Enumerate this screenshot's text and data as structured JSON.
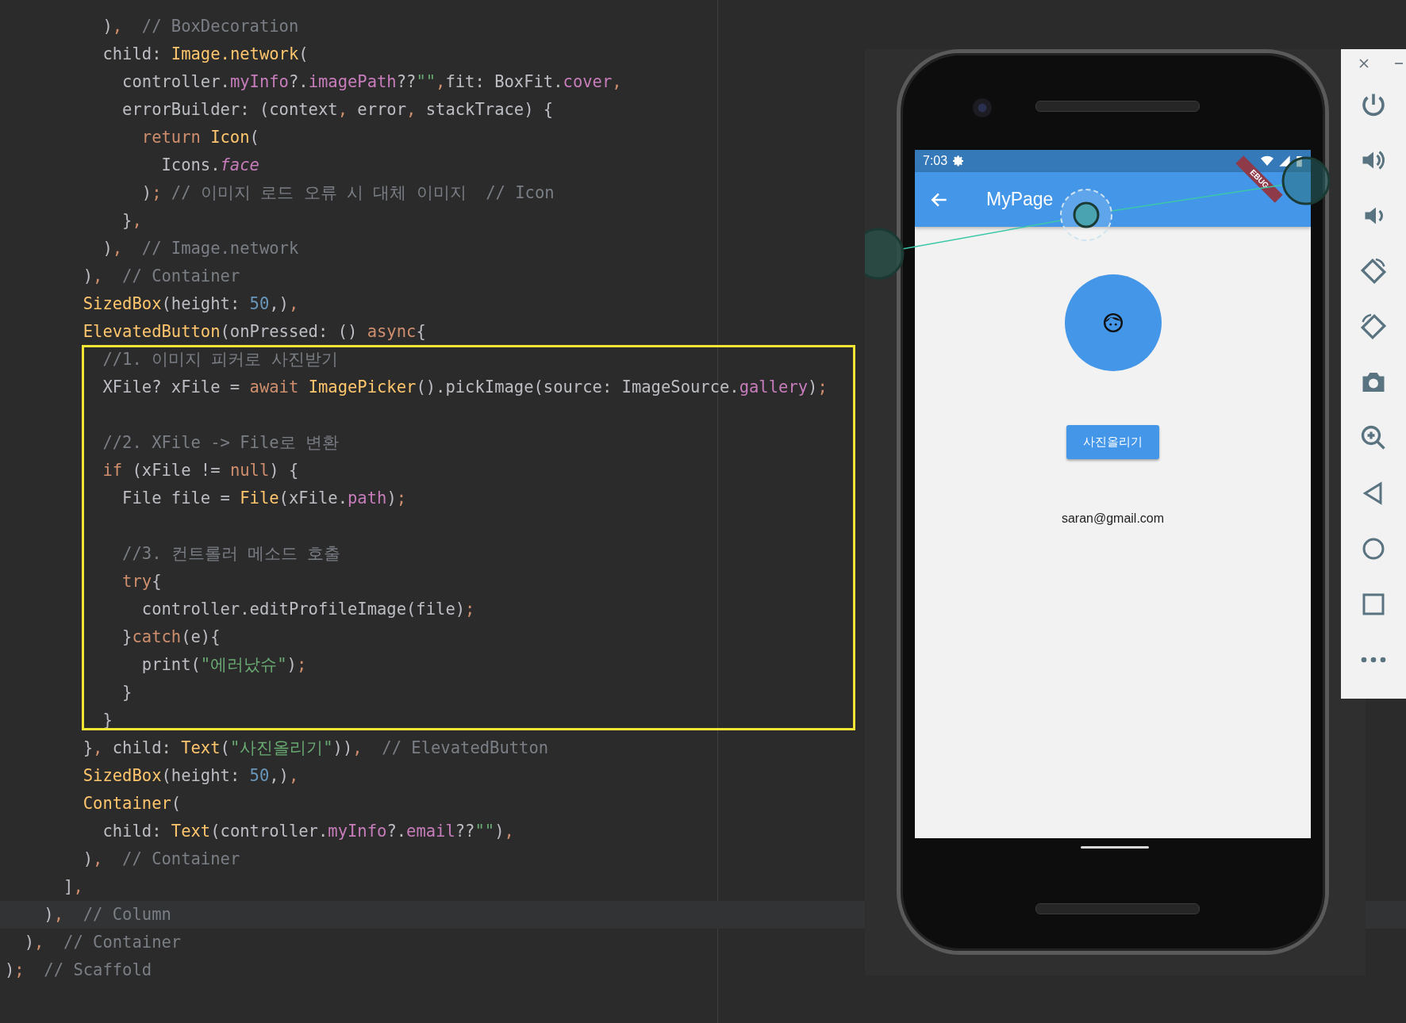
{
  "editor": {
    "lines": [
      {
        "current": false,
        "tokens": [
          {
            "kind": "plain",
            "text": "          )"
          },
          {
            "kind": "keyword",
            "text": ","
          },
          {
            "kind": "comment",
            "text": "  // BoxDecoration"
          }
        ]
      },
      {
        "current": false,
        "tokens": [
          {
            "kind": "plain",
            "text": "          child: "
          },
          {
            "kind": "class",
            "text": "Image.network"
          },
          {
            "kind": "plain",
            "text": "("
          }
        ]
      },
      {
        "current": false,
        "tokens": [
          {
            "kind": "plain",
            "text": "            controller."
          },
          {
            "kind": "field",
            "text": "myInfo"
          },
          {
            "kind": "plain",
            "text": "?."
          },
          {
            "kind": "field",
            "text": "imagePath"
          },
          {
            "kind": "plain",
            "text": "??"
          },
          {
            "kind": "string",
            "text": "\"\""
          },
          {
            "kind": "keyword",
            "text": ","
          },
          {
            "kind": "plain",
            "text": "fit: BoxFit."
          },
          {
            "kind": "field",
            "text": "cover"
          },
          {
            "kind": "keyword",
            "text": ","
          }
        ]
      },
      {
        "current": false,
        "tokens": [
          {
            "kind": "plain",
            "text": "            errorBuilder: (context"
          },
          {
            "kind": "keyword",
            "text": ","
          },
          {
            "kind": "plain",
            "text": " error"
          },
          {
            "kind": "keyword",
            "text": ","
          },
          {
            "kind": "plain",
            "text": " stackTrace) {"
          }
        ]
      },
      {
        "current": false,
        "tokens": [
          {
            "kind": "keyword",
            "text": "              return "
          },
          {
            "kind": "class",
            "text": "Icon"
          },
          {
            "kind": "plain",
            "text": "("
          }
        ]
      },
      {
        "current": false,
        "tokens": [
          {
            "kind": "plain",
            "text": "                Icons."
          },
          {
            "kind": "italic",
            "text": "face"
          }
        ]
      },
      {
        "current": false,
        "tokens": [
          {
            "kind": "plain",
            "text": "              )"
          },
          {
            "kind": "keyword",
            "text": ";"
          },
          {
            "kind": "comment",
            "text": " // 이미지 로드 오류 시 대체 이미지  // Icon"
          }
        ]
      },
      {
        "current": false,
        "tokens": [
          {
            "kind": "plain",
            "text": "            }"
          },
          {
            "kind": "keyword",
            "text": ","
          }
        ]
      },
      {
        "current": false,
        "tokens": [
          {
            "kind": "plain",
            "text": "          )"
          },
          {
            "kind": "keyword",
            "text": ","
          },
          {
            "kind": "comment",
            "text": "  // Image.network"
          }
        ]
      },
      {
        "current": false,
        "tokens": [
          {
            "kind": "plain",
            "text": "        )"
          },
          {
            "kind": "keyword",
            "text": ","
          },
          {
            "kind": "comment",
            "text": "  // Container"
          }
        ]
      },
      {
        "current": false,
        "tokens": [
          {
            "kind": "class",
            "text": "        SizedBox"
          },
          {
            "kind": "plain",
            "text": "(height: "
          },
          {
            "kind": "number",
            "text": "50"
          },
          {
            "kind": "plain",
            "text": ",)"
          },
          {
            "kind": "keyword",
            "text": ","
          }
        ]
      },
      {
        "current": false,
        "tokens": [
          {
            "kind": "class",
            "text": "        ElevatedButton"
          },
          {
            "kind": "plain",
            "text": "(onPressed: () "
          },
          {
            "kind": "keyword",
            "text": "async"
          },
          {
            "kind": "plain",
            "text": "{"
          }
        ]
      },
      {
        "current": false,
        "tokens": [
          {
            "kind": "comment",
            "text": "          //1. 이미지 피커로 사진받기"
          }
        ]
      },
      {
        "current": false,
        "tokens": [
          {
            "kind": "plain",
            "text": "          XFile? xFile = "
          },
          {
            "kind": "keyword",
            "text": "await "
          },
          {
            "kind": "class",
            "text": "ImagePicker"
          },
          {
            "kind": "plain",
            "text": "().pickImage(source: ImageSource."
          },
          {
            "kind": "field",
            "text": "gallery"
          },
          {
            "kind": "plain",
            "text": ")"
          },
          {
            "kind": "keyword",
            "text": ";"
          }
        ]
      },
      {
        "current": false
      },
      {
        "current": false,
        "tokens": [
          {
            "kind": "comment",
            "text": "          //2. XFile -> File로 변환"
          }
        ]
      },
      {
        "current": false,
        "tokens": [
          {
            "kind": "keyword",
            "text": "          if "
          },
          {
            "kind": "plain",
            "text": "(xFile != "
          },
          {
            "kind": "keyword",
            "text": "null"
          },
          {
            "kind": "plain",
            "text": ") {"
          }
        ]
      },
      {
        "current": false,
        "tokens": [
          {
            "kind": "plain",
            "text": "            File file = "
          },
          {
            "kind": "class",
            "text": "File"
          },
          {
            "kind": "plain",
            "text": "(xFile."
          },
          {
            "kind": "field",
            "text": "path"
          },
          {
            "kind": "plain",
            "text": ")"
          },
          {
            "kind": "keyword",
            "text": ";"
          }
        ]
      },
      {
        "current": false
      },
      {
        "current": false,
        "tokens": [
          {
            "kind": "comment",
            "text": "            //3. 컨트롤러 메소드 호출"
          }
        ]
      },
      {
        "current": false,
        "tokens": [
          {
            "kind": "keyword",
            "text": "            try"
          },
          {
            "kind": "plain",
            "text": "{"
          }
        ]
      },
      {
        "current": false,
        "tokens": [
          {
            "kind": "plain",
            "text": "              controller.editProfileImage(file)"
          },
          {
            "kind": "keyword",
            "text": ";"
          }
        ]
      },
      {
        "current": false,
        "tokens": [
          {
            "kind": "plain",
            "text": "            }"
          },
          {
            "kind": "keyword",
            "text": "catch"
          },
          {
            "kind": "plain",
            "text": "(e){"
          }
        ]
      },
      {
        "current": false,
        "tokens": [
          {
            "kind": "plain",
            "text": "              print("
          },
          {
            "kind": "string",
            "text": "\"에러났슈\""
          },
          {
            "kind": "plain",
            "text": ")"
          },
          {
            "kind": "keyword",
            "text": ";"
          }
        ]
      },
      {
        "current": false,
        "tokens": [
          {
            "kind": "plain",
            "text": "            }"
          }
        ]
      },
      {
        "current": false,
        "tokens": [
          {
            "kind": "plain",
            "text": "          }"
          }
        ]
      },
      {
        "current": false,
        "tokens": [
          {
            "kind": "plain",
            "text": "        }"
          },
          {
            "kind": "keyword",
            "text": ", "
          },
          {
            "kind": "plain",
            "text": "child: "
          },
          {
            "kind": "class",
            "text": "Text"
          },
          {
            "kind": "plain",
            "text": "("
          },
          {
            "kind": "string",
            "text": "\"사진올리기\""
          },
          {
            "kind": "plain",
            "text": "))"
          },
          {
            "kind": "keyword",
            "text": ","
          },
          {
            "kind": "comment",
            "text": "  // ElevatedButton"
          }
        ]
      },
      {
        "current": false,
        "tokens": [
          {
            "kind": "class",
            "text": "        SizedBox"
          },
          {
            "kind": "plain",
            "text": "(height: "
          },
          {
            "kind": "number",
            "text": "50"
          },
          {
            "kind": "plain",
            "text": ",)"
          },
          {
            "kind": "keyword",
            "text": ","
          }
        ]
      },
      {
        "current": false,
        "tokens": [
          {
            "kind": "class",
            "text": "        Container"
          },
          {
            "kind": "plain",
            "text": "("
          }
        ]
      },
      {
        "current": false,
        "tokens": [
          {
            "kind": "plain",
            "text": "          child: "
          },
          {
            "kind": "class",
            "text": "Text"
          },
          {
            "kind": "plain",
            "text": "(controller."
          },
          {
            "kind": "field",
            "text": "myInfo"
          },
          {
            "kind": "plain",
            "text": "?."
          },
          {
            "kind": "field",
            "text": "email"
          },
          {
            "kind": "plain",
            "text": "??"
          },
          {
            "kind": "string",
            "text": "\"\""
          },
          {
            "kind": "plain",
            "text": ")"
          },
          {
            "kind": "keyword",
            "text": ","
          }
        ]
      },
      {
        "current": false,
        "tokens": [
          {
            "kind": "plain",
            "text": "        )"
          },
          {
            "kind": "keyword",
            "text": ","
          },
          {
            "kind": "comment",
            "text": "  // Container"
          }
        ]
      },
      {
        "current": false,
        "tokens": [
          {
            "kind": "plain",
            "text": "      ]"
          },
          {
            "kind": "keyword",
            "text": ","
          }
        ]
      },
      {
        "current": true,
        "tokens": [
          {
            "kind": "plain",
            "text": "    )"
          },
          {
            "kind": "keyword",
            "text": ","
          },
          {
            "kind": "comment",
            "text": "  // Column"
          }
        ]
      },
      {
        "current": false,
        "tokens": [
          {
            "kind": "plain",
            "text": "  )"
          },
          {
            "kind": "keyword",
            "text": ","
          },
          {
            "kind": "comment",
            "text": "  // Container"
          }
        ]
      },
      {
        "current": false,
        "tokens": [
          {
            "kind": "plain",
            "text": ")"
          },
          {
            "kind": "keyword",
            "text": ";"
          },
          {
            "kind": "comment",
            "text": "  // Scaffold"
          }
        ]
      }
    ]
  },
  "emulator": {
    "status_bar": {
      "time": "7:03"
    },
    "debug_banner": "EBUG",
    "app_bar": {
      "title": "MyPage"
    },
    "upload_button": "사진올리기",
    "email": "saran@gmail.com"
  }
}
